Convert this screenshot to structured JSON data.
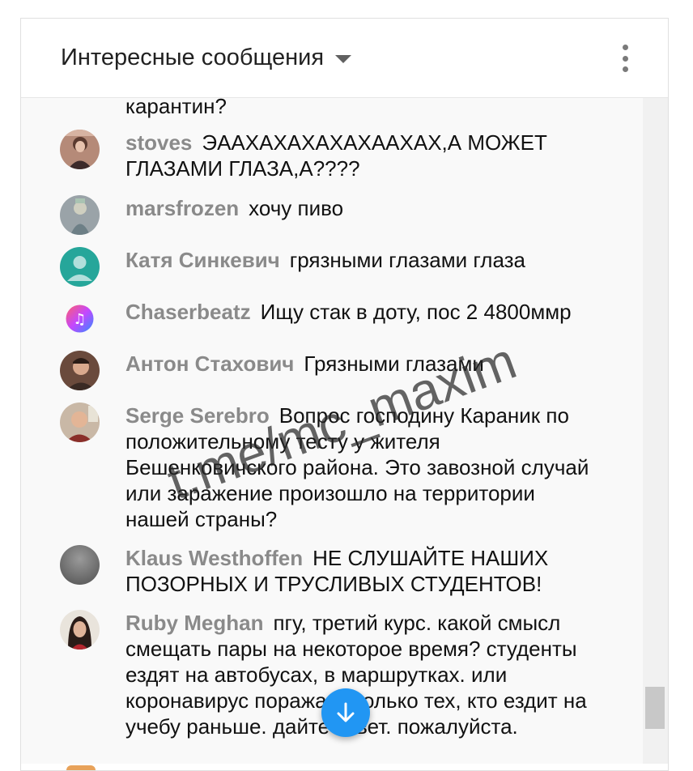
{
  "header": {
    "title": "Интересные сообщения"
  },
  "clipped_line": "карантин?",
  "messages": [
    {
      "author": "stoves",
      "text": "ЭААХАХАХАХАХААХАХ,А МОЖЕТ ГЛАЗАМИ ГЛАЗА,А????"
    },
    {
      "author": "marsfrozen",
      "text": "хочу пиво"
    },
    {
      "author": "Катя Синкевич",
      "text": "грязными глазами глаза"
    },
    {
      "author": "Chaserbeatz",
      "text": "Ищу стак в доту, пос 2 4800ммр"
    },
    {
      "author": "Антон Стахович",
      "text": "Грязными глазами"
    },
    {
      "author": "Serge Serebro",
      "text": "Вопрос господину Караник по положительному тесту у жителя Бешенковичского района. Это завозной случай или заражение произошло на территории нашей страны?"
    },
    {
      "author": "Klaus Westhoffen",
      "text": "НЕ СЛУШАЙТЕ НАШИХ ПОЗОРНЫХ И ТРУСЛИВЫХ СТУДЕНТОВ!"
    },
    {
      "author": "Ruby Meghan",
      "text": "пгу, третий курс. какой смысл смещать пары на некоторое время? студенты ездят на автобусах, в маршрутках. или коронавирус поражает только тех, кто ездит на учебу раньше. дайте ответ. пожалуйста."
    }
  ],
  "watermark": "t.me/mc_maxim",
  "colors": {
    "accent": "#2196f3",
    "author": "#8a8a8a",
    "text": "#111111"
  }
}
